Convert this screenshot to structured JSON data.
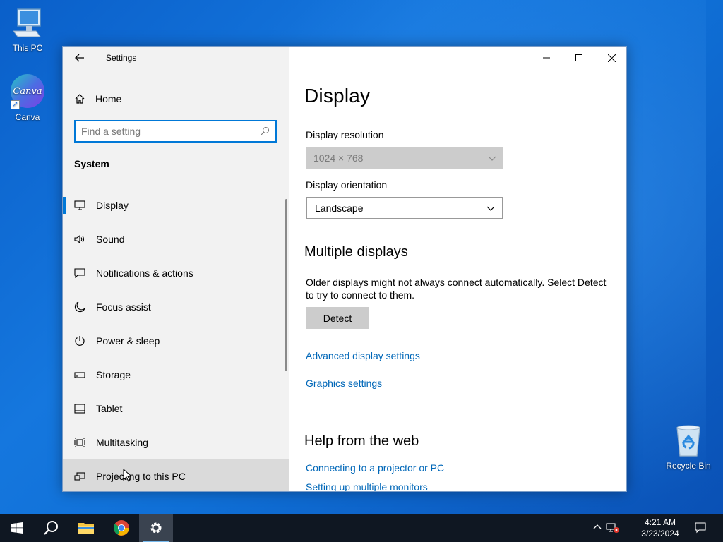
{
  "desktop": {
    "icons": [
      {
        "label": "This PC"
      },
      {
        "label": "Canva",
        "logo_text": "Canva"
      },
      {
        "label": "Recycle Bin"
      }
    ]
  },
  "window": {
    "app_title": "Settings",
    "sidebar": {
      "home_label": "Home",
      "search_placeholder": "Find a setting",
      "section_label": "System",
      "items": [
        {
          "label": "Display",
          "icon": "monitor-icon"
        },
        {
          "label": "Sound",
          "icon": "speaker-icon"
        },
        {
          "label": "Notifications & actions",
          "icon": "notification-icon"
        },
        {
          "label": "Focus assist",
          "icon": "moon-icon"
        },
        {
          "label": "Power & sleep",
          "icon": "power-icon"
        },
        {
          "label": "Storage",
          "icon": "storage-icon"
        },
        {
          "label": "Tablet",
          "icon": "tablet-icon"
        },
        {
          "label": "Multitasking",
          "icon": "multitasking-icon"
        },
        {
          "label": "Projecting to this PC",
          "icon": "projecting-icon"
        }
      ]
    },
    "content": {
      "page_title": "Display",
      "resolution": {
        "label": "Display resolution",
        "value": "1024 × 768"
      },
      "orientation": {
        "label": "Display orientation",
        "value": "Landscape"
      },
      "multiple_displays": {
        "heading": "Multiple displays",
        "description": "Older displays might not always connect automatically. Select Detect to try to connect to them.",
        "detect_label": "Detect"
      },
      "links": {
        "advanced": "Advanced display settings",
        "graphics": "Graphics settings"
      },
      "help": {
        "heading": "Help from the web",
        "links": [
          "Connecting to a projector or PC",
          "Setting up multiple monitors"
        ]
      }
    }
  },
  "taskbar": {
    "time": "4:21 AM",
    "date": "3/23/2024"
  },
  "colors": {
    "accent": "#0078d7",
    "link": "#0067b8",
    "taskbar": "#0f1722"
  }
}
